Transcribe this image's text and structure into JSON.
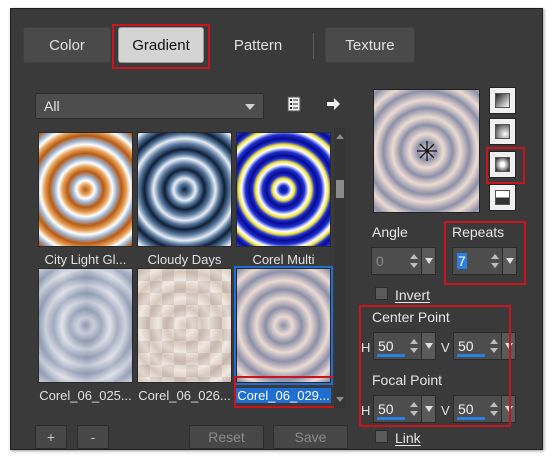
{
  "tabs": [
    {
      "label": "Color"
    },
    {
      "label": "Gradient"
    },
    {
      "label": "Pattern"
    },
    {
      "label": "Texture"
    }
  ],
  "category_select": {
    "value": "All"
  },
  "gallery": {
    "items": [
      {
        "name": "City Light Gl..."
      },
      {
        "name": "Cloudy Days"
      },
      {
        "name": "Corel Multi"
      },
      {
        "name": "Corel_06_025..."
      },
      {
        "name": "Corel_06_026..."
      },
      {
        "name": "Corel_06_029..."
      }
    ]
  },
  "buttons": {
    "add": "+",
    "remove": "-",
    "reset": "Reset",
    "save": "Save"
  },
  "angle": {
    "label": "Angle",
    "value": "0"
  },
  "repeats": {
    "label": "Repeats",
    "value": "7"
  },
  "invert": {
    "label": "Invert"
  },
  "center_point": {
    "label": "Center Point",
    "h_label": "H",
    "h_value": "50",
    "v_label": "V",
    "v_value": "50"
  },
  "focal_point": {
    "label": "Focal Point",
    "h_label": "H",
    "h_value": "50",
    "v_label": "V",
    "v_value": "50"
  },
  "link": {
    "label": "Link"
  },
  "colors": {
    "accent": "#2c7fe0",
    "highlight": "#c8141e",
    "panel": "#3a3a3a"
  }
}
